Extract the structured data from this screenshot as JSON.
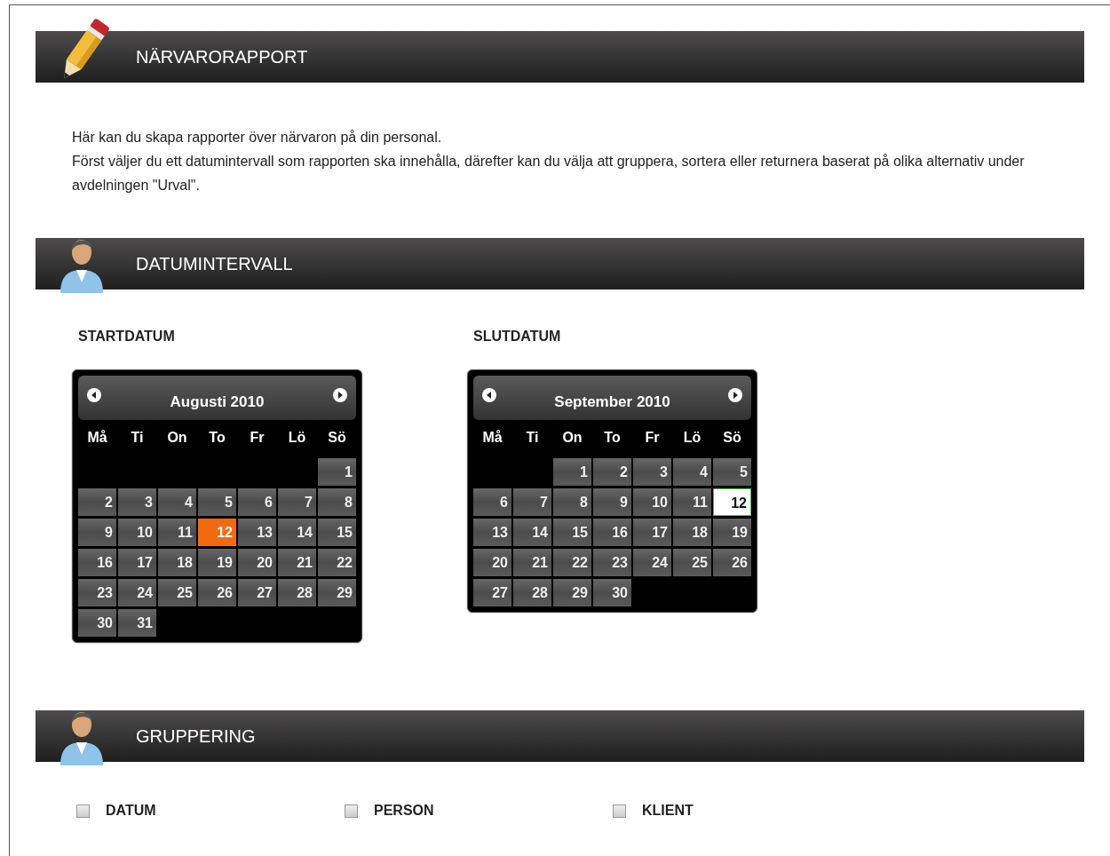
{
  "sections": [
    {
      "kind": "report",
      "title": "NÄRVARORAPPORT"
    },
    {
      "kind": "dates",
      "title": "DATUMINTERVALL"
    },
    {
      "kind": "grouping",
      "title": "GRUPPERING"
    }
  ],
  "intro": [
    "Här kan du skapa rapporter över närvaron på din personal.",
    "Först väljer du ett datumintervall som rapporten ska innehålla, därefter kan du välja att gruppera, sortera eller returnera baserat på olika alternativ under avdelningen \"Urval\"."
  ],
  "calendars": [
    {
      "label": "STARTDATUM",
      "month": "Augusti 2010",
      "weekdays": [
        "Må",
        "Ti",
        "On",
        "To",
        "Fr",
        "Lö",
        "Sö"
      ],
      "weeks": [
        [
          {
            "kind": "empty"
          },
          {
            "kind": "empty"
          },
          {
            "kind": "empty"
          },
          {
            "kind": "empty"
          },
          {
            "kind": "empty"
          },
          {
            "kind": "empty"
          },
          {
            "kind": "day",
            "d": "1",
            "selected": false,
            "today": false
          }
        ],
        [
          {
            "kind": "day",
            "d": "2",
            "selected": false,
            "today": false
          },
          {
            "kind": "day",
            "d": "3",
            "selected": false,
            "today": false
          },
          {
            "kind": "day",
            "d": "4",
            "selected": false,
            "today": false
          },
          {
            "kind": "day",
            "d": "5",
            "selected": false,
            "today": false
          },
          {
            "kind": "day",
            "d": "6",
            "selected": false,
            "today": false
          },
          {
            "kind": "day",
            "d": "7",
            "selected": false,
            "today": false
          },
          {
            "kind": "day",
            "d": "8",
            "selected": false,
            "today": false
          }
        ],
        [
          {
            "kind": "day",
            "d": "9",
            "selected": false,
            "today": false
          },
          {
            "kind": "day",
            "d": "10",
            "selected": false,
            "today": false
          },
          {
            "kind": "day",
            "d": "11",
            "selected": false,
            "today": false
          },
          {
            "kind": "day",
            "d": "12",
            "selected": true,
            "today": false
          },
          {
            "kind": "day",
            "d": "13",
            "selected": false,
            "today": false
          },
          {
            "kind": "day",
            "d": "14",
            "selected": false,
            "today": false
          },
          {
            "kind": "day",
            "d": "15",
            "selected": false,
            "today": false
          }
        ],
        [
          {
            "kind": "day",
            "d": "16",
            "selected": false,
            "today": false
          },
          {
            "kind": "day",
            "d": "17",
            "selected": false,
            "today": false
          },
          {
            "kind": "day",
            "d": "18",
            "selected": false,
            "today": false
          },
          {
            "kind": "day",
            "d": "19",
            "selected": false,
            "today": false
          },
          {
            "kind": "day",
            "d": "20",
            "selected": false,
            "today": false
          },
          {
            "kind": "day",
            "d": "21",
            "selected": false,
            "today": false
          },
          {
            "kind": "day",
            "d": "22",
            "selected": false,
            "today": false
          }
        ],
        [
          {
            "kind": "day",
            "d": "23",
            "selected": false,
            "today": false
          },
          {
            "kind": "day",
            "d": "24",
            "selected": false,
            "today": false
          },
          {
            "kind": "day",
            "d": "25",
            "selected": false,
            "today": false
          },
          {
            "kind": "day",
            "d": "26",
            "selected": false,
            "today": false
          },
          {
            "kind": "day",
            "d": "27",
            "selected": false,
            "today": false
          },
          {
            "kind": "day",
            "d": "28",
            "selected": false,
            "today": false
          },
          {
            "kind": "day",
            "d": "29",
            "selected": false,
            "today": false
          }
        ],
        [
          {
            "kind": "day",
            "d": "30",
            "selected": false,
            "today": false
          },
          {
            "kind": "day",
            "d": "31",
            "selected": false,
            "today": false
          },
          {
            "kind": "empty"
          },
          {
            "kind": "empty"
          },
          {
            "kind": "empty"
          },
          {
            "kind": "empty"
          },
          {
            "kind": "empty"
          }
        ]
      ]
    },
    {
      "label": "SLUTDATUM",
      "month": "September 2010",
      "weekdays": [
        "Må",
        "Ti",
        "On",
        "To",
        "Fr",
        "Lö",
        "Sö"
      ],
      "weeks": [
        [
          {
            "kind": "empty"
          },
          {
            "kind": "empty"
          },
          {
            "kind": "day",
            "d": "1",
            "selected": false,
            "today": false
          },
          {
            "kind": "day",
            "d": "2",
            "selected": false,
            "today": false
          },
          {
            "kind": "day",
            "d": "3",
            "selected": false,
            "today": false
          },
          {
            "kind": "day",
            "d": "4",
            "selected": false,
            "today": false
          },
          {
            "kind": "day",
            "d": "5",
            "selected": false,
            "today": false
          }
        ],
        [
          {
            "kind": "day",
            "d": "6",
            "selected": false,
            "today": false
          },
          {
            "kind": "day",
            "d": "7",
            "selected": false,
            "today": false
          },
          {
            "kind": "day",
            "d": "8",
            "selected": false,
            "today": false
          },
          {
            "kind": "day",
            "d": "9",
            "selected": false,
            "today": false
          },
          {
            "kind": "day",
            "d": "10",
            "selected": false,
            "today": false
          },
          {
            "kind": "day",
            "d": "11",
            "selected": false,
            "today": false
          },
          {
            "kind": "day",
            "d": "12",
            "selected": false,
            "today": true
          }
        ],
        [
          {
            "kind": "day",
            "d": "13",
            "selected": false,
            "today": false
          },
          {
            "kind": "day",
            "d": "14",
            "selected": false,
            "today": false
          },
          {
            "kind": "day",
            "d": "15",
            "selected": false,
            "today": false
          },
          {
            "kind": "day",
            "d": "16",
            "selected": false,
            "today": false
          },
          {
            "kind": "day",
            "d": "17",
            "selected": false,
            "today": false
          },
          {
            "kind": "day",
            "d": "18",
            "selected": false,
            "today": false
          },
          {
            "kind": "day",
            "d": "19",
            "selected": false,
            "today": false
          }
        ],
        [
          {
            "kind": "day",
            "d": "20",
            "selected": false,
            "today": false
          },
          {
            "kind": "day",
            "d": "21",
            "selected": false,
            "today": false
          },
          {
            "kind": "day",
            "d": "22",
            "selected": false,
            "today": false
          },
          {
            "kind": "day",
            "d": "23",
            "selected": false,
            "today": false
          },
          {
            "kind": "day",
            "d": "24",
            "selected": false,
            "today": false
          },
          {
            "kind": "day",
            "d": "25",
            "selected": false,
            "today": false
          },
          {
            "kind": "day",
            "d": "26",
            "selected": false,
            "today": false
          }
        ],
        [
          {
            "kind": "day",
            "d": "27",
            "selected": false,
            "today": false
          },
          {
            "kind": "day",
            "d": "28",
            "selected": false,
            "today": false
          },
          {
            "kind": "day",
            "d": "29",
            "selected": false,
            "today": false
          },
          {
            "kind": "day",
            "d": "30",
            "selected": false,
            "today": false
          },
          {
            "kind": "empty"
          },
          {
            "kind": "empty"
          },
          {
            "kind": "empty"
          }
        ]
      ]
    }
  ],
  "grouping": [
    {
      "label": "DATUM",
      "checked": false
    },
    {
      "label": "PERSON",
      "checked": false
    },
    {
      "label": "KLIENT",
      "checked": false
    }
  ]
}
